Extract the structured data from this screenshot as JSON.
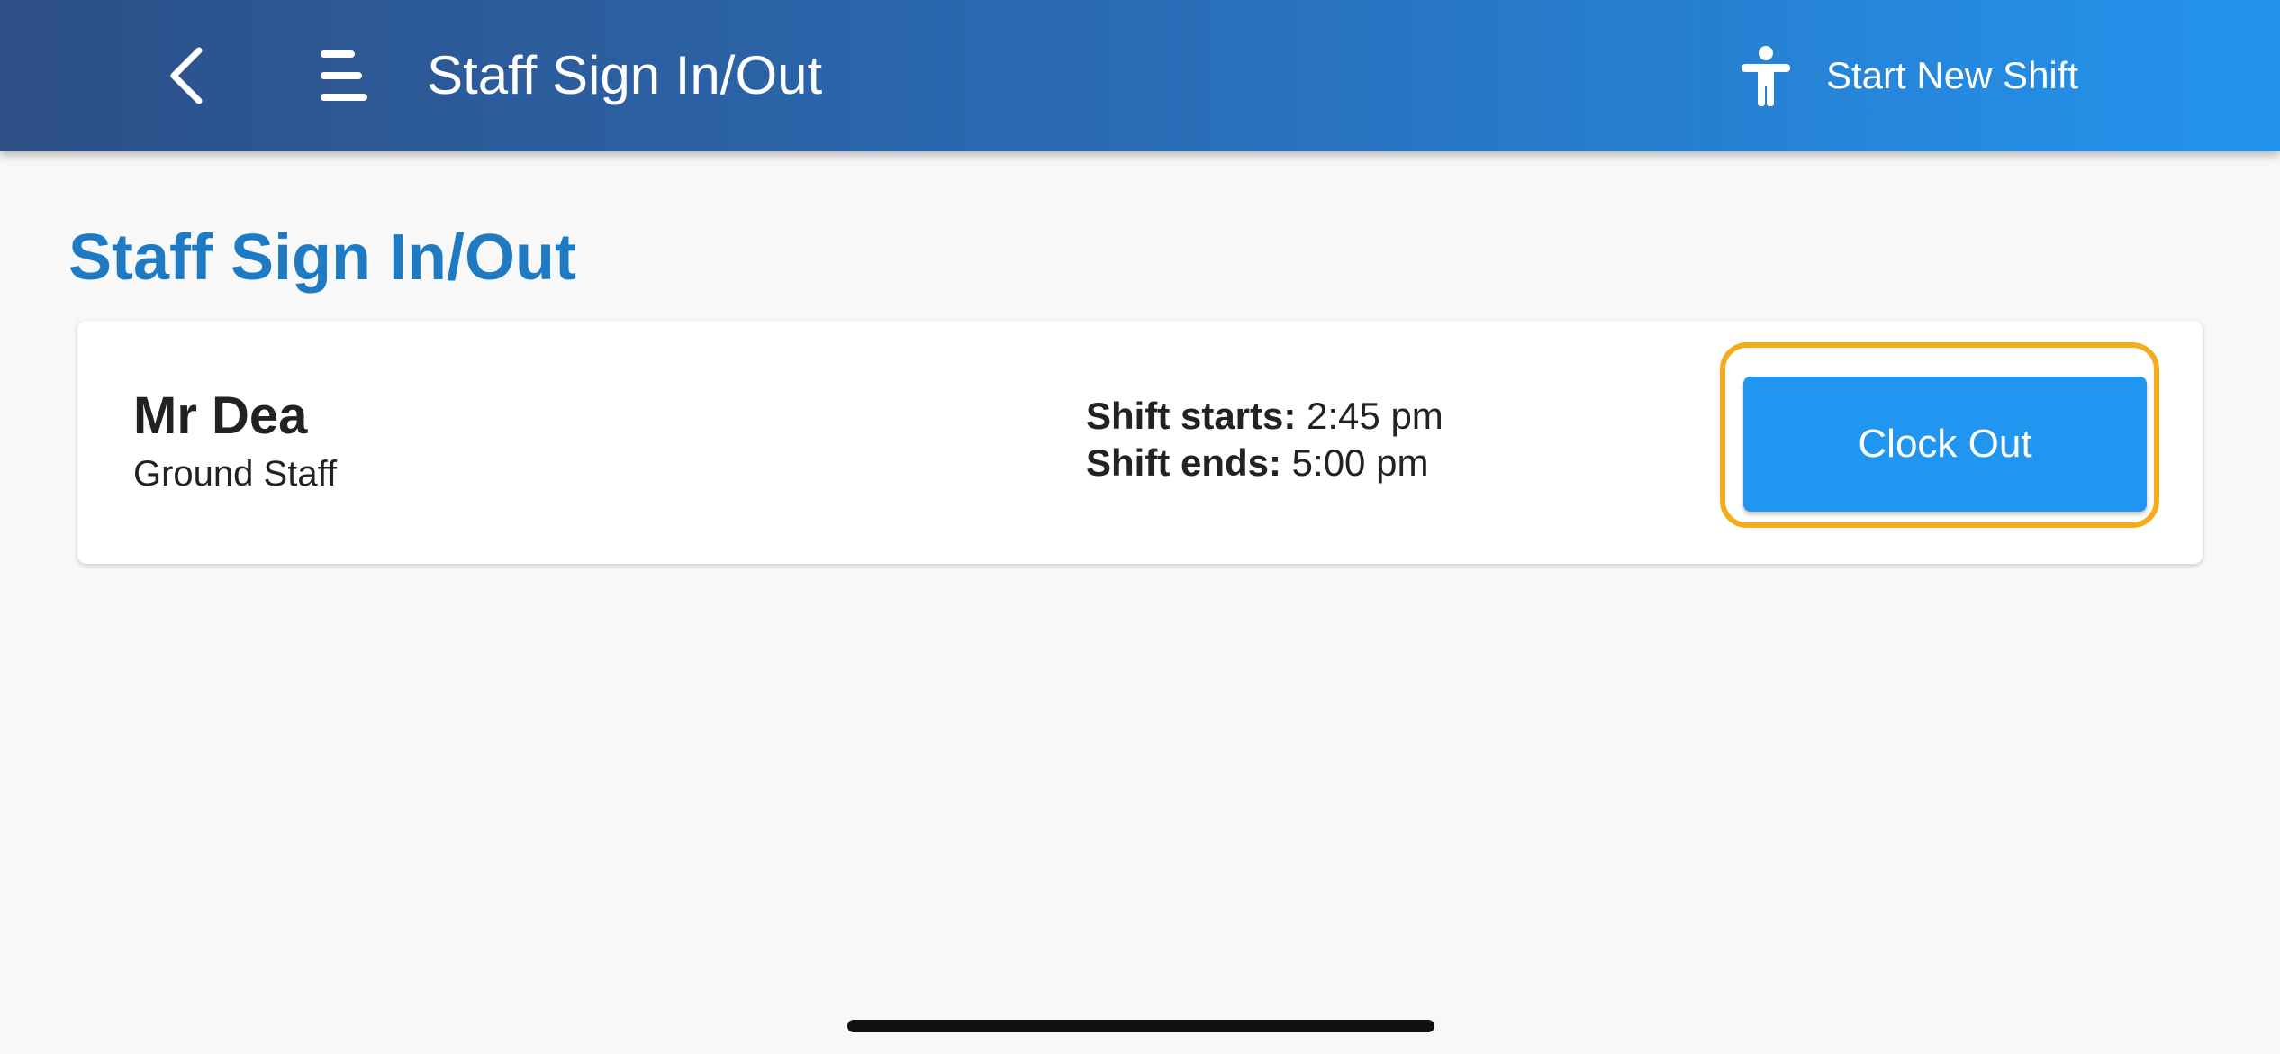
{
  "appbar": {
    "title": "Staff Sign In/Out",
    "back_icon": "chevron-left-icon",
    "menu_icon": "menu-icon",
    "new_shift": {
      "icon": "accessibility-person-icon",
      "label": "Start New Shift"
    }
  },
  "page": {
    "title": "Staff Sign In/Out"
  },
  "staff_card": {
    "name": "Mr Dea",
    "role": "Ground Staff",
    "shift_starts_label": "Shift starts:",
    "shift_starts_value": "2:45 pm",
    "shift_ends_label": "Shift ends:",
    "shift_ends_value": "5:00 pm",
    "action_label": "Clock Out"
  },
  "colors": {
    "appbar_start": "#2d4f86",
    "appbar_end": "#2394ee",
    "title_blue": "#1f7ac4",
    "button_blue": "#2196f0",
    "focus_ring": "#f4ad1a"
  }
}
